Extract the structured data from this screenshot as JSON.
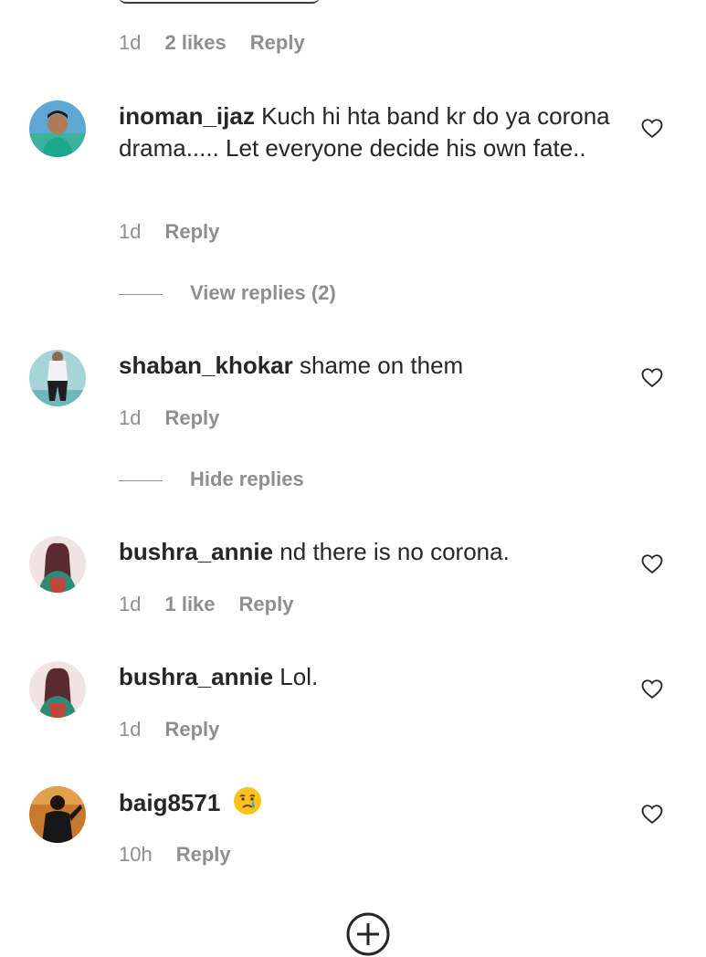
{
  "top_meta": {
    "time": "1d",
    "likes": "2 likes",
    "reply": "Reply"
  },
  "comments": [
    {
      "username": "inoman_ijaz",
      "text": "Kuch hi hta band kr do ya corona drama..... Let everyone decide his own fate..",
      "time": "1d",
      "likes": "",
      "reply": "Reply",
      "view_replies": "View replies (2)"
    },
    {
      "username": "shaban_khokar",
      "text": "shame on them",
      "time": "1d",
      "likes": "",
      "reply": "Reply",
      "hide_replies": "Hide replies"
    },
    {
      "username": "bushra_annie",
      "text": "nd there is no corona.",
      "time": "1d",
      "likes": "1 like",
      "reply": "Reply"
    },
    {
      "username": "bushra_annie",
      "text": "Lol.",
      "time": "1d",
      "likes": "",
      "reply": "Reply"
    },
    {
      "username": "baig8571",
      "text": "",
      "emoji": "crying-face-emoji",
      "time": "10h",
      "likes": "",
      "reply": "Reply"
    }
  ],
  "icons": {
    "heart": "heart-icon",
    "add": "add-comment-icon"
  },
  "colors": {
    "text": "#262626",
    "secondary": "#8e8e8e",
    "background": "#ffffff"
  }
}
